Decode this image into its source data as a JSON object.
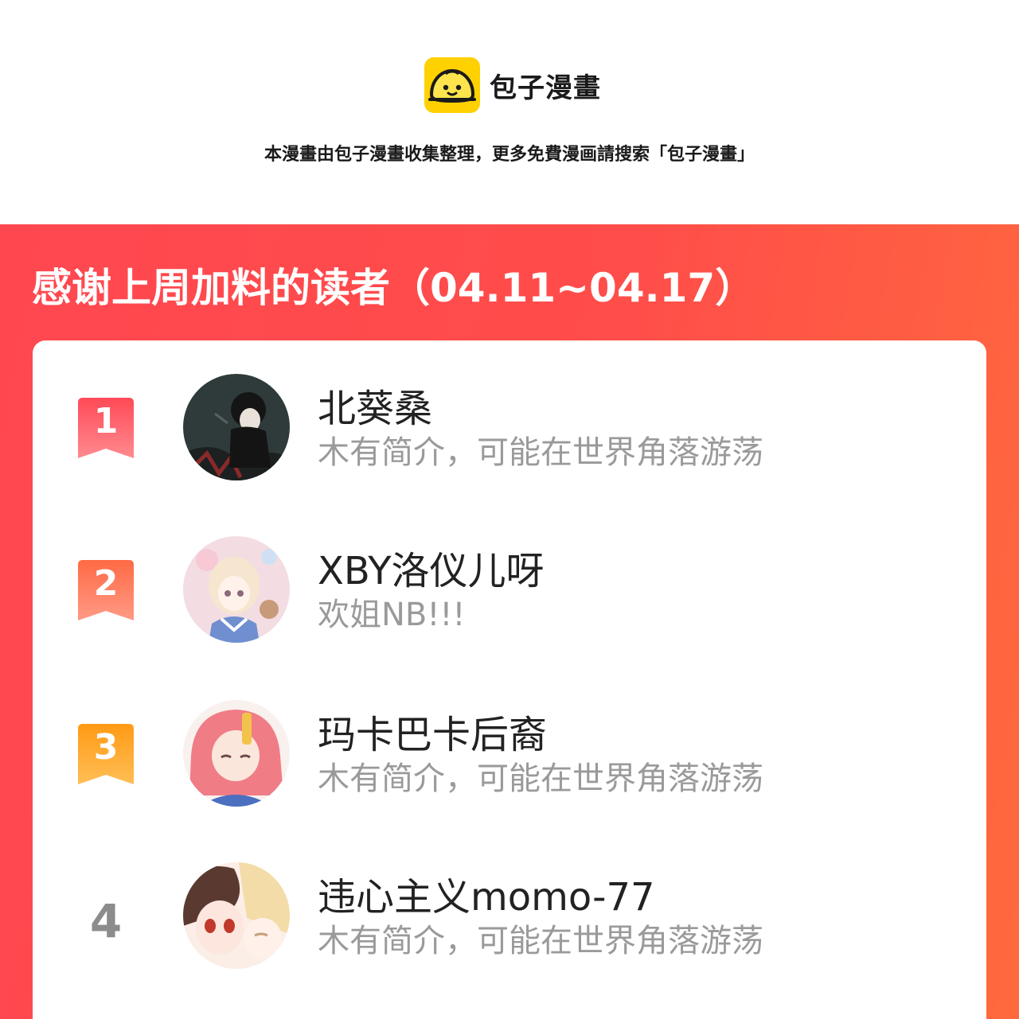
{
  "header": {
    "brand_name": "包子漫畫",
    "notice": "本漫畫由包子漫畫收集整理，更多免費漫画請搜索「包子漫畫」"
  },
  "panel": {
    "title": "感谢上周加料的读者（04.11~04.17）"
  },
  "readers": [
    {
      "rank": "1",
      "name": "北葵桑",
      "bio": "木有简介，可能在世界角落游荡"
    },
    {
      "rank": "2",
      "name": "XBY洛仪儿呀",
      "bio": "欢姐NB!!!"
    },
    {
      "rank": "3",
      "name": "玛卡巴卡后裔",
      "bio": "木有简介，可能在世界角落游荡"
    },
    {
      "rank": "4",
      "name": "违心主义momo-77",
      "bio": "木有简介，可能在世界角落游荡"
    }
  ],
  "colors": {
    "brand_yellow": "#ffd100",
    "panel_red": "#ff4750",
    "rank1": "#ff5a66",
    "rank2": "#ff7a55",
    "rank3": "#ffa41f",
    "rank_plain": "#8c8c8c"
  },
  "icons": {
    "logo": "bun-face-icon",
    "rank_badge": "bookmark-ribbon-icon"
  }
}
